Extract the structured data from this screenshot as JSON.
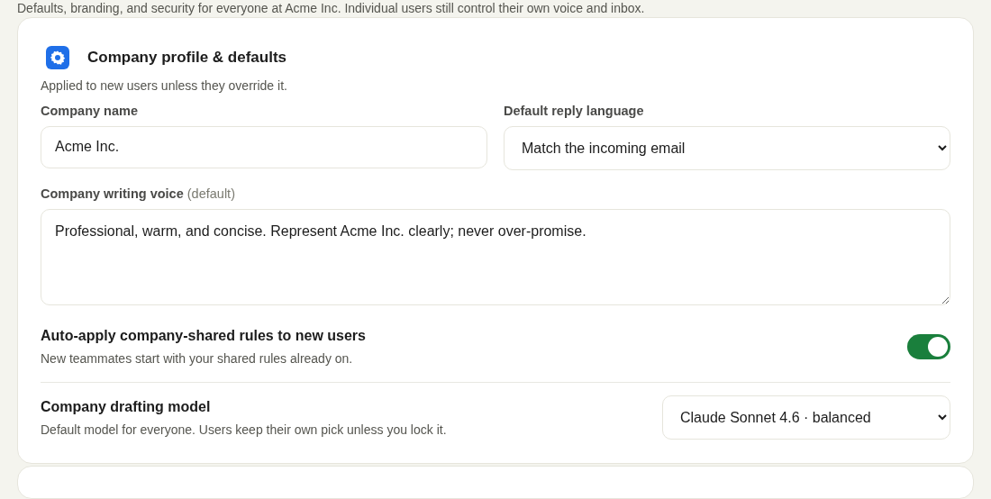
{
  "intro": "Defaults, branding, and security for everyone at Acme Inc. Individual users still control their own voice and inbox.",
  "card": {
    "title": "Company profile & defaults",
    "subtitle": "Applied to new users unless they override it.",
    "company_name": {
      "label": "Company name",
      "value": "Acme Inc."
    },
    "reply_language": {
      "label": "Default reply language",
      "value": "Match the incoming email"
    },
    "voice": {
      "label": "Company writing voice",
      "hint": "(default)",
      "value": "Professional, warm, and concise. Represent Acme Inc. clearly; never over-promise."
    },
    "auto_apply": {
      "title": "Auto-apply company-shared rules to new users",
      "description": "New teammates start with your shared rules already on.",
      "on": true
    },
    "model": {
      "title": "Company drafting model",
      "description": "Default model for everyone. Users keep their own pick unless you lock it.",
      "value": "Claude Sonnet 4.6 · balanced"
    }
  }
}
